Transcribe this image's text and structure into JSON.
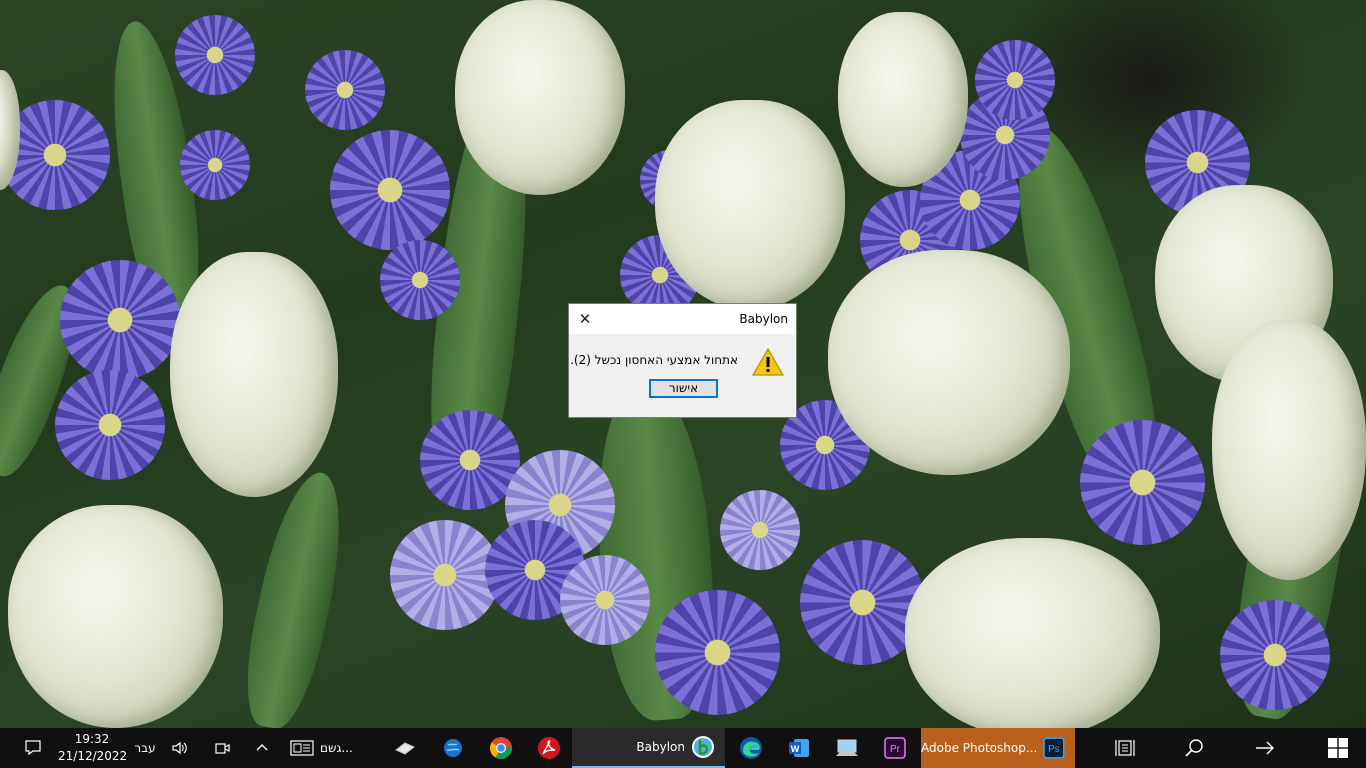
{
  "dialog": {
    "title": "Babylon",
    "message": "אתחול אמצעי האחסון נכשל (2).",
    "ok_label": "אישור",
    "close_icon": "close-icon",
    "warning_icon": "warning-icon"
  },
  "taskbar": {
    "clock_time": "19:32",
    "clock_date": "21/12/2022",
    "language": "עבר",
    "news_label": "גשם...",
    "apps": [
      {
        "label": "Babylon",
        "icon": "babylon-icon"
      },
      {
        "label": "Adobe Photoshop...",
        "icon": "photoshop-icon"
      }
    ],
    "icons": [
      "notification-icon",
      "volume-icon",
      "meet-now-icon",
      "chevron-up-icon",
      "news-icon",
      "eraser-icon",
      "globe-icon",
      "chrome-icon",
      "acrobat-icon",
      "edge-icon",
      "word-icon",
      "computer-icon",
      "premiere-icon",
      "task-view-icon",
      "search-icon",
      "arrow-icon",
      "windows-start-icon"
    ],
    "colors": {
      "background": "#101010",
      "active_app": "#2b2b2b",
      "active_indicator": "#76b9ed",
      "photoshop_highlight": "#b9611c"
    }
  }
}
